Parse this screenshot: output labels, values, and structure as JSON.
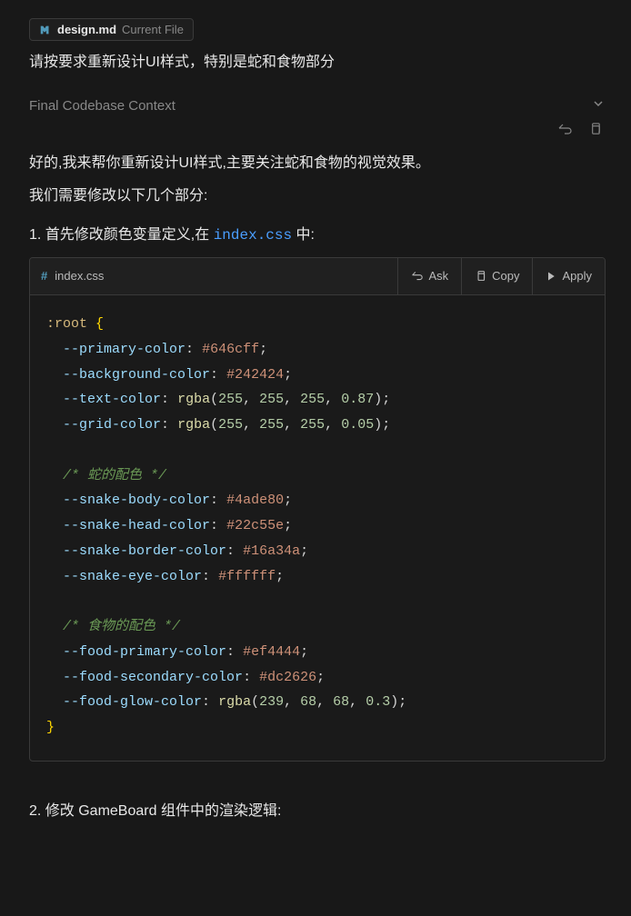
{
  "fileChip": {
    "icon": "markdown-icon",
    "name": "design.md",
    "suffix": "Current File"
  },
  "userPrompt": "请按要求重新设计UI样式，特别是蛇和食物部分",
  "contextHeader": "Final Codebase Context",
  "responseIntro1": "好的,我来帮你重新设计UI样式,主要关注蛇和食物的视觉效果。",
  "responseIntro2": "我们需要修改以下几个部分:",
  "step1_prefix": "1. 首先修改颜色变量定义,在 ",
  "step1_file": "index.css",
  "step1_suffix": " 中:",
  "codeBlock": {
    "filename": "index.css",
    "actions": {
      "ask": "Ask",
      "copy": "Copy",
      "apply": "Apply"
    },
    "code": {
      "selector": ":root",
      "props": [
        {
          "name": "--primary-color",
          "value_hex": "#646cff"
        },
        {
          "name": "--background-color",
          "value_hex": "#242424"
        },
        {
          "name": "--text-color",
          "func": "rgba",
          "args": [
            "255",
            "255",
            "255",
            "0.87"
          ]
        },
        {
          "name": "--grid-color",
          "func": "rgba",
          "args": [
            "255",
            "255",
            "255",
            "0.05"
          ]
        }
      ],
      "comment_snake": "/* 蛇的配色 */",
      "snake": [
        {
          "name": "--snake-body-color",
          "value_hex": "#4ade80"
        },
        {
          "name": "--snake-head-color",
          "value_hex": "#22c55e"
        },
        {
          "name": "--snake-border-color",
          "value_hex": "#16a34a"
        },
        {
          "name": "--snake-eye-color",
          "value_hex": "#ffffff"
        }
      ],
      "comment_food": "/* 食物的配色 */",
      "food": [
        {
          "name": "--food-primary-color",
          "value_hex": "#ef4444"
        },
        {
          "name": "--food-secondary-color",
          "value_hex": "#dc2626"
        },
        {
          "name": "--food-glow-color",
          "func": "rgba",
          "args": [
            "239",
            "68",
            "68",
            "0.3"
          ]
        }
      ]
    }
  },
  "step2": "2. 修改 GameBoard 组件中的渲染逻辑:"
}
